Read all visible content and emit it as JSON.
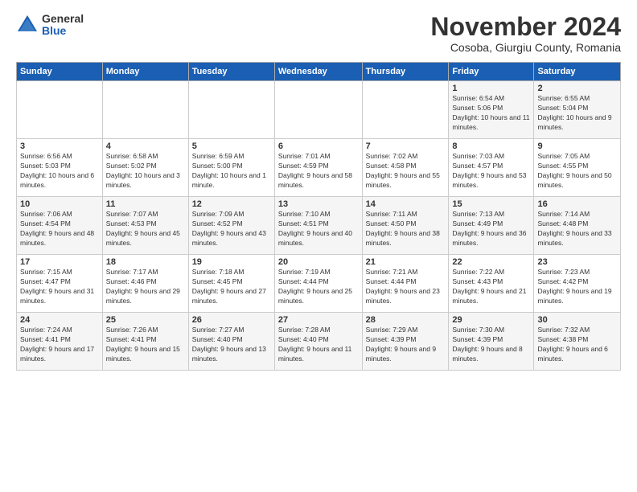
{
  "logo": {
    "general": "General",
    "blue": "Blue"
  },
  "title": "November 2024",
  "location": "Cosoba, Giurgiu County, Romania",
  "headers": [
    "Sunday",
    "Monday",
    "Tuesday",
    "Wednesday",
    "Thursday",
    "Friday",
    "Saturday"
  ],
  "weeks": [
    [
      {
        "day": "",
        "info": ""
      },
      {
        "day": "",
        "info": ""
      },
      {
        "day": "",
        "info": ""
      },
      {
        "day": "",
        "info": ""
      },
      {
        "day": "",
        "info": ""
      },
      {
        "day": "1",
        "info": "Sunrise: 6:54 AM\nSunset: 5:06 PM\nDaylight: 10 hours and 11 minutes."
      },
      {
        "day": "2",
        "info": "Sunrise: 6:55 AM\nSunset: 5:04 PM\nDaylight: 10 hours and 9 minutes."
      }
    ],
    [
      {
        "day": "3",
        "info": "Sunrise: 6:56 AM\nSunset: 5:03 PM\nDaylight: 10 hours and 6 minutes."
      },
      {
        "day": "4",
        "info": "Sunrise: 6:58 AM\nSunset: 5:02 PM\nDaylight: 10 hours and 3 minutes."
      },
      {
        "day": "5",
        "info": "Sunrise: 6:59 AM\nSunset: 5:00 PM\nDaylight: 10 hours and 1 minute."
      },
      {
        "day": "6",
        "info": "Sunrise: 7:01 AM\nSunset: 4:59 PM\nDaylight: 9 hours and 58 minutes."
      },
      {
        "day": "7",
        "info": "Sunrise: 7:02 AM\nSunset: 4:58 PM\nDaylight: 9 hours and 55 minutes."
      },
      {
        "day": "8",
        "info": "Sunrise: 7:03 AM\nSunset: 4:57 PM\nDaylight: 9 hours and 53 minutes."
      },
      {
        "day": "9",
        "info": "Sunrise: 7:05 AM\nSunset: 4:55 PM\nDaylight: 9 hours and 50 minutes."
      }
    ],
    [
      {
        "day": "10",
        "info": "Sunrise: 7:06 AM\nSunset: 4:54 PM\nDaylight: 9 hours and 48 minutes."
      },
      {
        "day": "11",
        "info": "Sunrise: 7:07 AM\nSunset: 4:53 PM\nDaylight: 9 hours and 45 minutes."
      },
      {
        "day": "12",
        "info": "Sunrise: 7:09 AM\nSunset: 4:52 PM\nDaylight: 9 hours and 43 minutes."
      },
      {
        "day": "13",
        "info": "Sunrise: 7:10 AM\nSunset: 4:51 PM\nDaylight: 9 hours and 40 minutes."
      },
      {
        "day": "14",
        "info": "Sunrise: 7:11 AM\nSunset: 4:50 PM\nDaylight: 9 hours and 38 minutes."
      },
      {
        "day": "15",
        "info": "Sunrise: 7:13 AM\nSunset: 4:49 PM\nDaylight: 9 hours and 36 minutes."
      },
      {
        "day": "16",
        "info": "Sunrise: 7:14 AM\nSunset: 4:48 PM\nDaylight: 9 hours and 33 minutes."
      }
    ],
    [
      {
        "day": "17",
        "info": "Sunrise: 7:15 AM\nSunset: 4:47 PM\nDaylight: 9 hours and 31 minutes."
      },
      {
        "day": "18",
        "info": "Sunrise: 7:17 AM\nSunset: 4:46 PM\nDaylight: 9 hours and 29 minutes."
      },
      {
        "day": "19",
        "info": "Sunrise: 7:18 AM\nSunset: 4:45 PM\nDaylight: 9 hours and 27 minutes."
      },
      {
        "day": "20",
        "info": "Sunrise: 7:19 AM\nSunset: 4:44 PM\nDaylight: 9 hours and 25 minutes."
      },
      {
        "day": "21",
        "info": "Sunrise: 7:21 AM\nSunset: 4:44 PM\nDaylight: 9 hours and 23 minutes."
      },
      {
        "day": "22",
        "info": "Sunrise: 7:22 AM\nSunset: 4:43 PM\nDaylight: 9 hours and 21 minutes."
      },
      {
        "day": "23",
        "info": "Sunrise: 7:23 AM\nSunset: 4:42 PM\nDaylight: 9 hours and 19 minutes."
      }
    ],
    [
      {
        "day": "24",
        "info": "Sunrise: 7:24 AM\nSunset: 4:41 PM\nDaylight: 9 hours and 17 minutes."
      },
      {
        "day": "25",
        "info": "Sunrise: 7:26 AM\nSunset: 4:41 PM\nDaylight: 9 hours and 15 minutes."
      },
      {
        "day": "26",
        "info": "Sunrise: 7:27 AM\nSunset: 4:40 PM\nDaylight: 9 hours and 13 minutes."
      },
      {
        "day": "27",
        "info": "Sunrise: 7:28 AM\nSunset: 4:40 PM\nDaylight: 9 hours and 11 minutes."
      },
      {
        "day": "28",
        "info": "Sunrise: 7:29 AM\nSunset: 4:39 PM\nDaylight: 9 hours and 9 minutes."
      },
      {
        "day": "29",
        "info": "Sunrise: 7:30 AM\nSunset: 4:39 PM\nDaylight: 9 hours and 8 minutes."
      },
      {
        "day": "30",
        "info": "Sunrise: 7:32 AM\nSunset: 4:38 PM\nDaylight: 9 hours and 6 minutes."
      }
    ]
  ]
}
